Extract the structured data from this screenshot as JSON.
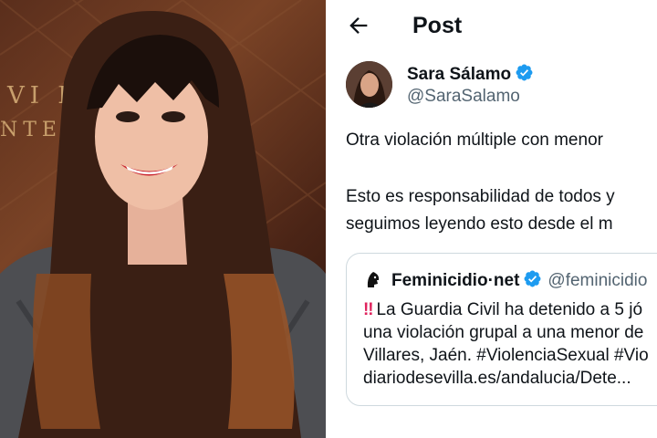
{
  "photo": {
    "sign_line1": "VI          E",
    "sign_line2": "NTE"
  },
  "header": {
    "title": "Post"
  },
  "author": {
    "name": "Sara Sálamo",
    "handle": "@SaraSalamo"
  },
  "post": {
    "line1": "Otra violación múltiple con menor",
    "line2": "Esto es responsabilidad de todos y",
    "line3": "seguimos leyendo esto desde el m"
  },
  "quoted": {
    "name": "Feminicidio·net",
    "handle": "@feminicidio",
    "bangs": "‼",
    "line1": "La Guardia Civil ha detenido a 5 jó",
    "line2": "una violación grupal a una menor de",
    "line3": "Villares, Jaén. #ViolenciaSexual #Vio",
    "line4": "diariodesevilla.es/andalucia/Dete..."
  },
  "colors": {
    "verified": "#1d9bf0",
    "secondary_text": "#536471",
    "alert": "#e0245e"
  }
}
